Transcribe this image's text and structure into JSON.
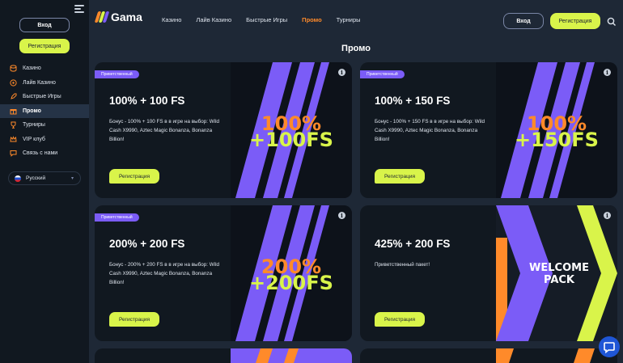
{
  "sidebar": {
    "login_label": "Вход",
    "register_label": "Регистрация",
    "items": [
      {
        "label": "Казино",
        "icon": "coins-icon"
      },
      {
        "label": "Лайв Казино",
        "icon": "roulette-icon"
      },
      {
        "label": "Быстрые Игры",
        "icon": "rocket-icon"
      },
      {
        "label": "Промо",
        "icon": "gift-icon"
      },
      {
        "label": "Турниры",
        "icon": "trophy-icon"
      },
      {
        "label": "VIP клуб",
        "icon": "crown-icon"
      },
      {
        "label": "Связь с нами",
        "icon": "chat-icon"
      }
    ],
    "language": "Русский"
  },
  "header": {
    "logo_text": "Gama",
    "nav": [
      "Казино",
      "Лайв Казино",
      "Быстрые Игры",
      "Промо",
      "Турниры"
    ],
    "login_label": "Вход",
    "register_label": "Регистрация"
  },
  "main": {
    "title": "Промо",
    "cards": [
      {
        "badge": "Приветственный",
        "title": "100% + 100 FS",
        "description": "Бонус - 100% + 100 FS в в игре на выбор: Wild Cash X9990, Aztec Magic Bonanza, Bonanza Billion!",
        "button": "Регистрация",
        "art_line1": "100%",
        "art_line2": "+100FS"
      },
      {
        "badge": "Приветственный",
        "title": "100% + 150 FS",
        "description": "Бонус - 100% + 150 FS в в игре на выбор: Wild Cash X9990, Aztec Magic Bonanza, Bonanza Billion!",
        "button": "Регистрация",
        "art_line1": "100%",
        "art_line2": "+150FS"
      },
      {
        "badge": "Приветственный",
        "title": "200% + 200 FS",
        "description": "Бонус - 200% + 200 FS в в игре на выбор: Wild Cash X9990, Aztec Magic Bonanza, Bonanza Billion!",
        "button": "Регистрация",
        "art_line1": "200%",
        "art_line2": "+200FS"
      },
      {
        "badge": "",
        "title": "425% + 200 FS",
        "description": "Приветственный пакет!",
        "button": "Регистрация",
        "art_line1": "WELCOME",
        "art_line2": "PACK"
      }
    ]
  },
  "colors": {
    "accent_lime": "#d9f44a",
    "accent_orange": "#ff8a2a",
    "accent_purple": "#7b5cf7",
    "bg": "#1e2836"
  }
}
